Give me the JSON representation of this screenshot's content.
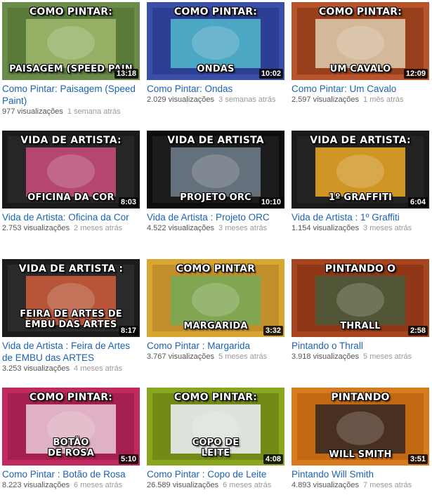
{
  "videos": [
    {
      "title": "Como Pintar: Paisagem (Speed Paint)",
      "views": "977 visualizações",
      "ago": "1 semana atrás",
      "duration": "13:18",
      "cap_top": "COMO PINTAR:",
      "cap_bottom": "PAISAGEM (SPEED PAIN",
      "bg": "#6a8b4a",
      "frame": "#5a7a3a",
      "art": "#9bb56a"
    },
    {
      "title": "Como Pintar: Ondas",
      "views": "2.029 visualizações",
      "ago": "3 semanas atrás",
      "duration": "10:02",
      "cap_top": "COMO PINTAR:",
      "cap_bottom": "ONDAS",
      "bg": "#3a4fa8",
      "frame": "#2c3f95",
      "art": "#4fb3c9"
    },
    {
      "title": "Como Pintar: Um Cavalo",
      "views": "2.597 visualizações",
      "ago": "1 mês atrás",
      "duration": "12:09",
      "cap_top": "COMO PINTAR:",
      "cap_bottom": "UM CAVALO",
      "bg": "#b8542c",
      "frame": "#9a3f1c",
      "art": "#d9c7a8"
    },
    {
      "title": "Vida de Artista: Oficina da Cor",
      "views": "2.753 visualizações",
      "ago": "2 meses atrás",
      "duration": "8:03",
      "cap_top": "VIDA DE ARTISTA:",
      "cap_bottom": "OFICINA DA COR",
      "bg": "#1a1a1a",
      "frame": "#262626",
      "art": "#c44a7a"
    },
    {
      "title": "Vida de Artista : Projeto ORC",
      "views": "4.522 visualizações",
      "ago": "3 meses atrás",
      "duration": "10:10",
      "cap_top": "VIDA DE ARTISTA",
      "cap_bottom": "PROJETO ORC",
      "bg": "#0d0d0d",
      "frame": "#1c1c1c",
      "art": "#6d7a86"
    },
    {
      "title": "Vida de Artista : 1º Graffiti",
      "views": "1.154 visualizações",
      "ago": "3 meses atrás",
      "duration": "6:04",
      "cap_top": "VIDA DE ARTISTA:",
      "cap_bottom": "1º GRAFFITI",
      "bg": "#1a1a1a",
      "frame": "#232323",
      "art": "#e3a326"
    },
    {
      "title": "Vida de Artista : Feira de Artes de EMBU das ARTES",
      "views": "3.253 visualizações",
      "ago": "4 meses atrás",
      "duration": "8:17",
      "cap_top": "VIDA DE ARTISTA :",
      "cap_bottom": "FEIRA DE ARTES DE",
      "cap_bottom2": "EMBU DAS ARTES",
      "bg": "#1c1c1c",
      "frame": "#2a2a2a",
      "art": "#c85a3a"
    },
    {
      "title": "Como Pintar : Margarida",
      "views": "3.767 visualizações",
      "ago": "5 meses atrás",
      "duration": "3:32",
      "cap_top": "COMO PINTAR",
      "cap_bottom": "MARGARIDA",
      "bg": "#d9a531",
      "frame": "#c2902a",
      "art": "#7aa856"
    },
    {
      "title": "Pintando o Thrall",
      "views": "3.918 visualizações",
      "ago": "5 meses atrás",
      "duration": "2:58",
      "cap_top": "PINTANDO O",
      "cap_bottom": "THRALL",
      "bg": "#a8451f",
      "frame": "#8f3716",
      "art": "#4d5a3a"
    },
    {
      "title": "Como Pintar : Botão de Rosa",
      "views": "8.223 visualizações",
      "ago": "6 meses atrás",
      "duration": "5:10",
      "cap_top": "COMO PINTAR:",
      "cap_bottom": "BOTÃO",
      "cap_bottom2": "DE ROSA",
      "bg": "#c0295f",
      "frame": "#a51f50",
      "art": "#e7c0d0"
    },
    {
      "title": "Como Pintar : Copo de Leite",
      "views": "26.589 visualizações",
      "ago": "6 meses atrás",
      "duration": "4:08",
      "cap_top": "COMO PINTAR:",
      "cap_bottom": "COPO DE",
      "cap_bottom2": "LEITE",
      "bg": "#8aa61e",
      "frame": "#728b17",
      "art": "#e8ecef"
    },
    {
      "title": "Pintando Will Smith",
      "views": "4.893 visualizações",
      "ago": "7 meses atrás",
      "duration": "3:51",
      "cap_top": "PINTANDO",
      "cap_bottom": "WILL SMITH",
      "bg": "#d87a1e",
      "frame": "#c26812",
      "art": "#3a2a22"
    }
  ]
}
